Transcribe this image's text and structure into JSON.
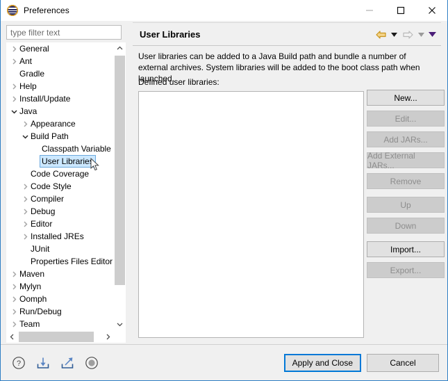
{
  "window": {
    "title": "Preferences",
    "icon": "eclipse-icon",
    "controls": {
      "minimize": "minimize-icon",
      "maximize": "maximize-icon",
      "close": "close-icon"
    }
  },
  "sidebar": {
    "filter": {
      "value": "",
      "placeholder": "type filter text"
    },
    "items": [
      {
        "label": "General",
        "indent": 0,
        "state": "collapsed",
        "selected": false
      },
      {
        "label": "Ant",
        "indent": 0,
        "state": "collapsed",
        "selected": false
      },
      {
        "label": "Gradle",
        "indent": 0,
        "state": "leaf",
        "selected": false
      },
      {
        "label": "Help",
        "indent": 0,
        "state": "collapsed",
        "selected": false
      },
      {
        "label": "Install/Update",
        "indent": 0,
        "state": "collapsed",
        "selected": false
      },
      {
        "label": "Java",
        "indent": 0,
        "state": "expanded",
        "selected": false
      },
      {
        "label": "Appearance",
        "indent": 1,
        "state": "collapsed",
        "selected": false
      },
      {
        "label": "Build Path",
        "indent": 1,
        "state": "expanded",
        "selected": false
      },
      {
        "label": "Classpath Variable",
        "indent": 2,
        "state": "leaf",
        "selected": false
      },
      {
        "label": "User Libraries",
        "indent": 2,
        "state": "leaf",
        "selected": true
      },
      {
        "label": "Code Coverage",
        "indent": 1,
        "state": "leaf",
        "selected": false
      },
      {
        "label": "Code Style",
        "indent": 1,
        "state": "collapsed",
        "selected": false
      },
      {
        "label": "Compiler",
        "indent": 1,
        "state": "collapsed",
        "selected": false
      },
      {
        "label": "Debug",
        "indent": 1,
        "state": "collapsed",
        "selected": false
      },
      {
        "label": "Editor",
        "indent": 1,
        "state": "collapsed",
        "selected": false
      },
      {
        "label": "Installed JREs",
        "indent": 1,
        "state": "collapsed",
        "selected": false
      },
      {
        "label": "JUnit",
        "indent": 1,
        "state": "leaf",
        "selected": false
      },
      {
        "label": "Properties Files Editor",
        "indent": 1,
        "state": "leaf",
        "selected": false
      },
      {
        "label": "Maven",
        "indent": 0,
        "state": "collapsed",
        "selected": false
      },
      {
        "label": "Mylyn",
        "indent": 0,
        "state": "collapsed",
        "selected": false
      },
      {
        "label": "Oomph",
        "indent": 0,
        "state": "collapsed",
        "selected": false
      },
      {
        "label": "Run/Debug",
        "indent": 0,
        "state": "collapsed",
        "selected": false
      },
      {
        "label": "Team",
        "indent": 0,
        "state": "collapsed",
        "selected": false
      }
    ]
  },
  "page": {
    "title": "User Libraries",
    "nav": {
      "back": "back-arrow-icon",
      "back_menu": "back-dropdown-icon",
      "forward": "forward-arrow-icon",
      "forward_menu": "forward-dropdown-icon",
      "view_menu": "view-menu-icon"
    },
    "description": "User libraries can be added to a Java Build path and bundle a number of external archives. System libraries will be added to the boot class path when launched.",
    "list_label": "Defined user libraries:",
    "list_items": [],
    "buttons": [
      {
        "label": "New...",
        "enabled": true
      },
      {
        "label": "Edit...",
        "enabled": false
      },
      {
        "label": "Add JARs...",
        "enabled": false
      },
      {
        "label": "Add External JARs...",
        "enabled": false
      },
      {
        "label": "Remove",
        "enabled": false
      },
      {
        "label": "Up",
        "enabled": false,
        "gap_above": true
      },
      {
        "label": "Down",
        "enabled": false
      },
      {
        "label": "Import...",
        "enabled": true,
        "gap_above": true
      },
      {
        "label": "Export...",
        "enabled": false
      }
    ]
  },
  "footer": {
    "icons": [
      {
        "name": "help-icon"
      },
      {
        "name": "import-preferences-icon"
      },
      {
        "name": "export-preferences-icon"
      },
      {
        "name": "record-icon"
      }
    ],
    "apply_label": "Apply and Close",
    "cancel_label": "Cancel"
  },
  "colors": {
    "focus_blue": "#0078d7",
    "selection_blue": "#cce8ff",
    "window_border": "#2e7ec4",
    "panel_bg": "#f0f0f0"
  }
}
